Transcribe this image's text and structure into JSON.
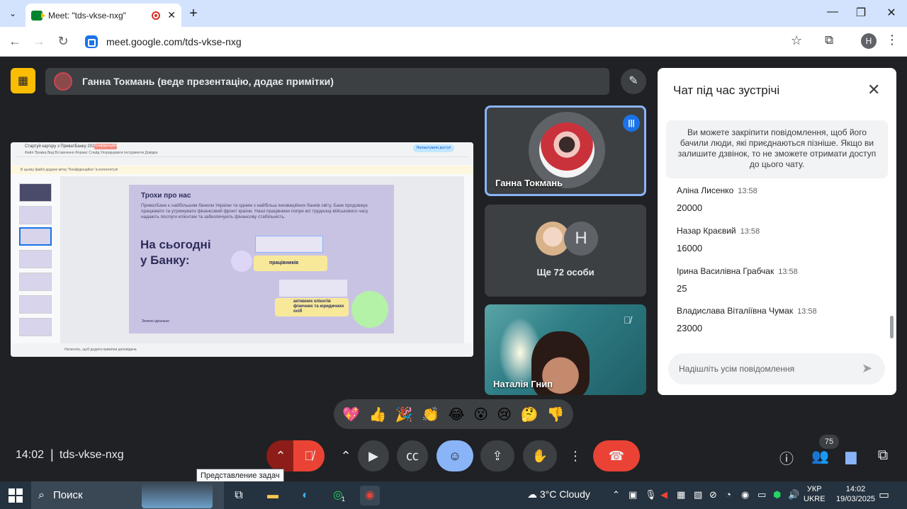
{
  "browser": {
    "tab_title": "Meet: \"tds-vkse-nxg\"",
    "tab_close": "✕",
    "new_tab": "+",
    "url": "meet.google.com/tds-vkse-nxg",
    "profile_initial": "H",
    "window_controls": [
      "—",
      "❐",
      "✕"
    ]
  },
  "meet": {
    "presenter_banner": "Ганна Токмань (веде презентацію, додає примітки)",
    "time": "14:02",
    "separator": "|",
    "meeting_code": "tds-vkse-nxg",
    "participants_badge": "75",
    "tooltip": "Представление задач"
  },
  "slide": {
    "doc_title": "Стартуй кар'єру з ПриватБанку 2025",
    "badge": "Конфіденційно",
    "menu": "Файл  Правка  Вид  Вставлення  Формат  Слайд  Упорядкувати  Інструменти  Довідка",
    "share": "Налаштувати доступ",
    "notice": "В цьому файлі додано мітку \"Конфіденційно\" в колонтитулі",
    "heading": "Трохи про нас",
    "paragraph": "ПриватБанк є найбільшим банком України та одним з найбільш інноваційних банків світу. Банк продовжує працювати та утримувати фінансовий фронт країни. Наші працівники попри всі труднощі військового часу надають послуги клієнтам та забезпечують фінансову стабільність.",
    "big_line1": "На сьогодні",
    "big_line2": "у Банку:",
    "pill1": "працівників",
    "pill2": "активних клієнтів фізичних та юридичних осіб",
    "logo": "Зелено ідеально",
    "notes_hint": "Натисніть, щоб додати примітки доповідача"
  },
  "tiles": {
    "main_speaker": "Ганна Токмань",
    "more_label": "Ще 72 особи",
    "more_initial": "H",
    "third_name": "Наталія Гнип"
  },
  "chat": {
    "title": "Чат під час зустрічі",
    "info": "Ви можете закріпити повідомлення, щоб його бачили люди, які приєднаються пізніше. Якщо ви залишите дзвінок, то не зможете отримати доступ до цього чату.",
    "messages": [
      {
        "author": "Аліна Лисенко",
        "time": "13:58",
        "text": "20000"
      },
      {
        "author": "Назар Краєвий",
        "time": "13:58",
        "text": "16000"
      },
      {
        "author": "Ірина Василівна Грабчак",
        "time": "13:58",
        "text": "25"
      },
      {
        "author": "Владислава Віталіївна Чумак",
        "time": "13:58",
        "text": "23000"
      }
    ],
    "input_placeholder": "Надішліть усім повідомлення"
  },
  "reactions": [
    "💖",
    "👍",
    "🎉",
    "👏",
    "😂",
    "😮",
    "😢",
    "🤔",
    "👎"
  ],
  "taskbar": {
    "search_label": "Поиск",
    "whatsapp_badge": "1",
    "weather": "3°C  Cloudy",
    "lang_top": "УКР",
    "lang_bottom": "UKRE",
    "time": "14:02",
    "date": "19/03/2025"
  },
  "colors": {
    "meet_bg": "#202124",
    "accent_blue": "#8ab4f8",
    "end_call_red": "#ea4335",
    "present_yellow": "#fbbc04"
  }
}
